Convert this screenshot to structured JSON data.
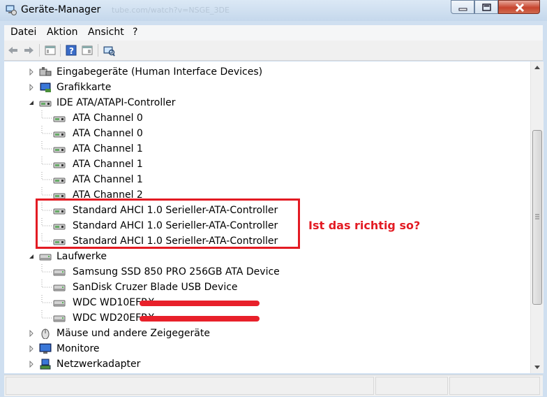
{
  "window": {
    "title": "Geräte-Manager",
    "ghost_text": "tube.com/watch?v=NSGE_3DE",
    "minimize_icon": "minimize-icon",
    "maximize_icon": "maximize-icon",
    "close_icon": "close-icon"
  },
  "menu": [
    "Datei",
    "Aktion",
    "Ansicht",
    "?"
  ],
  "toolbar": [
    "back-arrow-icon",
    "forward-arrow-icon",
    "properties-list-icon",
    "help-icon",
    "console-tree-icon",
    "scan-hardware-icon"
  ],
  "tree": {
    "items": [
      {
        "label": "Eingabegeräte (Human Interface Devices)",
        "icon": "hid-icon",
        "level": 0,
        "expander": "collapsed"
      },
      {
        "label": "Grafikkarte",
        "icon": "display-adapter-icon",
        "level": 0,
        "expander": "collapsed"
      },
      {
        "label": "IDE ATA/ATAPI-Controller",
        "icon": "ide-controller-icon",
        "level": 0,
        "expander": "expanded"
      },
      {
        "label": "ATA Channel 0",
        "icon": "ata-channel-icon",
        "level": 1
      },
      {
        "label": "ATA Channel 0",
        "icon": "ata-channel-icon",
        "level": 1
      },
      {
        "label": "ATA Channel 1",
        "icon": "ata-channel-icon",
        "level": 1
      },
      {
        "label": "ATA Channel 1",
        "icon": "ata-channel-icon",
        "level": 1
      },
      {
        "label": "ATA Channel 1",
        "icon": "ata-channel-icon",
        "level": 1
      },
      {
        "label": "ATA Channel 2",
        "icon": "ata-channel-icon",
        "level": 1
      },
      {
        "label": "Standard AHCI 1.0 Serieller-ATA-Controller",
        "icon": "sata-controller-icon",
        "level": 1
      },
      {
        "label": "Standard AHCI 1.0 Serieller-ATA-Controller",
        "icon": "sata-controller-icon",
        "level": 1
      },
      {
        "label": "Standard AHCI 1.0 Serieller-ATA-Controller",
        "icon": "sata-controller-icon",
        "level": 1
      },
      {
        "label": "Laufwerke",
        "icon": "disk-drive-icon",
        "level": 0,
        "expander": "expanded"
      },
      {
        "label": "Samsung SSD 850 PRO 256GB ATA Device",
        "icon": "disk-drive-icon",
        "level": 1
      },
      {
        "label": "SanDisk Cruzer Blade USB Device",
        "icon": "disk-drive-icon",
        "level": 1
      },
      {
        "label": "WDC WD10EFRX-",
        "icon": "disk-drive-icon",
        "level": 1,
        "redacted": true
      },
      {
        "label": "WDC WD20EFRX-",
        "icon": "disk-drive-icon",
        "level": 1,
        "redacted": true
      },
      {
        "label": "Mäuse und andere Zeigegeräte",
        "icon": "mouse-icon",
        "level": 0,
        "expander": "collapsed"
      },
      {
        "label": "Monitore",
        "icon": "monitor-icon",
        "level": 0,
        "expander": "collapsed"
      },
      {
        "label": "Netzwerkadapter",
        "icon": "network-adapter-icon",
        "level": 0,
        "expander": "collapsed"
      }
    ]
  },
  "annotation": "Ist das richtig so?",
  "colors": {
    "annotation": "#e31b23",
    "redaction": "#e8202a"
  }
}
